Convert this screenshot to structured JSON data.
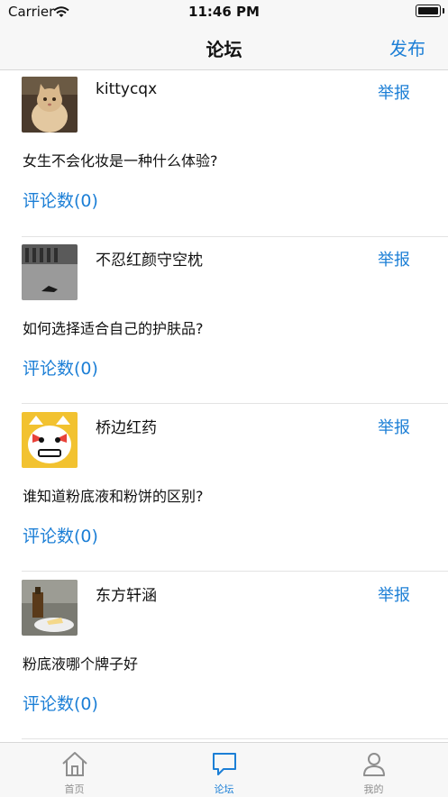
{
  "status_bar": {
    "carrier": "Carrier",
    "time": "11:46 PM"
  },
  "nav": {
    "title": "论坛",
    "publish_label": "发布"
  },
  "posts": [
    {
      "username": "kittycqx",
      "report_label": "举报",
      "question": "女生不会化妆是一种什么体验?",
      "comments_label": "评论数(0)",
      "avatar": "cat-photo"
    },
    {
      "username": "不忍红颜守空枕",
      "report_label": "举报",
      "question": "如何选择适合自己的护肤品?",
      "comments_label": "评论数(0)",
      "avatar": "street-photo"
    },
    {
      "username": "桥边红药",
      "report_label": "举报",
      "question": "谁知道粉底液和粉饼的区别?",
      "comments_label": "评论数(0)",
      "avatar": "cartoon-cat"
    },
    {
      "username": "东方轩涵",
      "report_label": "举报",
      "question": "粉底液哪个牌子好",
      "comments_label": "评论数(0)",
      "avatar": "food-photo"
    }
  ],
  "tabs": [
    {
      "label": "首页",
      "icon": "home-icon",
      "active": false
    },
    {
      "label": "论坛",
      "icon": "chat-bubble-icon",
      "active": true
    },
    {
      "label": "我的",
      "icon": "person-icon",
      "active": false
    }
  ],
  "colors": {
    "accent": "#1c7fd6",
    "inactive": "#8e8e8e",
    "bar_background": "#f7f7f7"
  }
}
